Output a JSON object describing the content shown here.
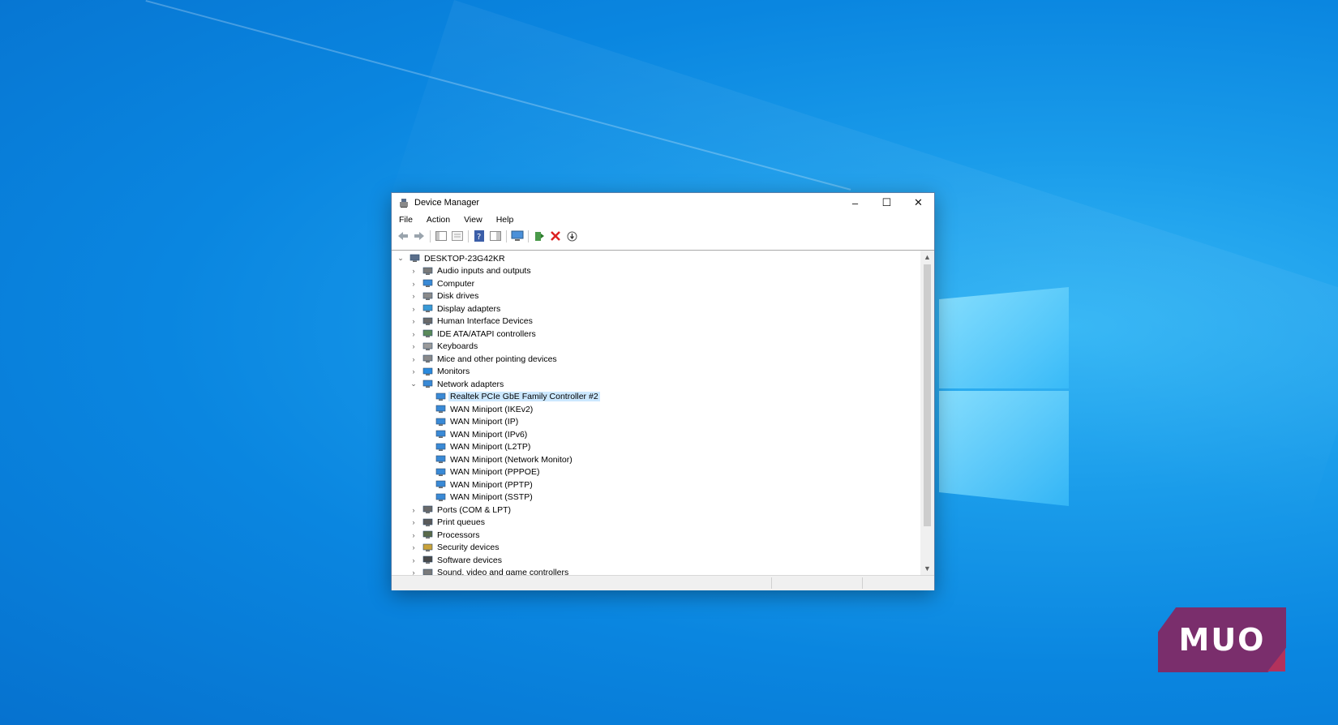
{
  "window": {
    "title": "Device Manager",
    "controls": {
      "minimize": "–",
      "maximize": "☐",
      "close": "✕"
    }
  },
  "menu": [
    "File",
    "Action",
    "View",
    "Help"
  ],
  "toolbar": [
    "back-icon",
    "forward-icon",
    "show-hide-console-tree-icon",
    "properties-icon",
    "help-icon",
    "action-pane-icon",
    "scan-hardware-icon",
    "update-driver-icon",
    "uninstall-device-icon",
    "disable-device-icon"
  ],
  "tree": {
    "root": "DESKTOP-23G42KR",
    "categories": [
      {
        "label": "Audio inputs and outputs",
        "icon": "speaker-icon"
      },
      {
        "label": "Computer",
        "icon": "computer-icon"
      },
      {
        "label": "Disk drives",
        "icon": "disk-icon"
      },
      {
        "label": "Display adapters",
        "icon": "display-adapter-icon"
      },
      {
        "label": "Human Interface Devices",
        "icon": "hid-icon"
      },
      {
        "label": "IDE ATA/ATAPI controllers",
        "icon": "ide-icon"
      },
      {
        "label": "Keyboards",
        "icon": "keyboard-icon"
      },
      {
        "label": "Mice and other pointing devices",
        "icon": "mouse-icon"
      },
      {
        "label": "Monitors",
        "icon": "monitor-icon"
      },
      {
        "label": "Network adapters",
        "icon": "network-icon",
        "expanded": true,
        "children": [
          "Realtek PCIe GbE Family Controller #2",
          "WAN Miniport (IKEv2)",
          "WAN Miniport (IP)",
          "WAN Miniport (IPv6)",
          "WAN Miniport (L2TP)",
          "WAN Miniport (Network Monitor)",
          "WAN Miniport (PPPOE)",
          "WAN Miniport (PPTP)",
          "WAN Miniport (SSTP)"
        ]
      },
      {
        "label": "Ports (COM & LPT)",
        "icon": "port-icon"
      },
      {
        "label": "Print queues",
        "icon": "printer-icon"
      },
      {
        "label": "Processors",
        "icon": "processor-icon"
      },
      {
        "label": "Security devices",
        "icon": "security-icon"
      },
      {
        "label": "Software devices",
        "icon": "software-device-icon"
      },
      {
        "label": "Sound, video and game controllers",
        "icon": "sound-icon"
      }
    ]
  },
  "colors": {
    "desktop": "#0a86e0",
    "selection": "#cce8ff",
    "window_border": "#5a7fa8",
    "brand": "#7a2e6c"
  },
  "watermark": "MUO"
}
